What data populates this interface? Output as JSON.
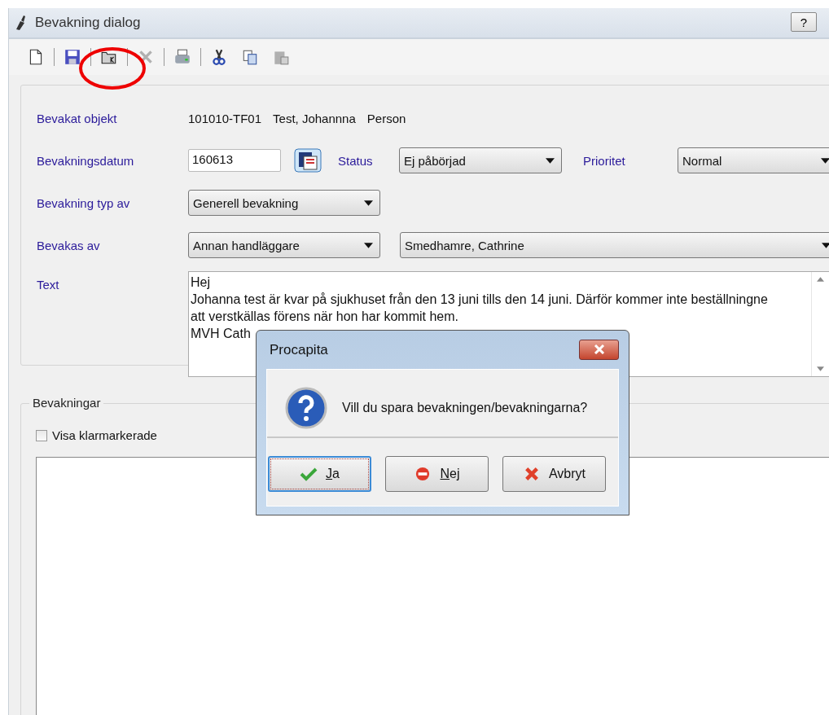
{
  "window": {
    "title": "Bevakning dialog",
    "help_button": "?"
  },
  "toolbar": {
    "groups": [
      [
        {
          "kind": "new",
          "disabled": false
        }
      ],
      [
        {
          "kind": "save",
          "disabled": false
        }
      ],
      [
        {
          "kind": "open",
          "disabled": false
        }
      ],
      [
        {
          "kind": "delete",
          "disabled": true
        }
      ],
      [
        {
          "kind": "print",
          "disabled": false
        }
      ],
      [
        {
          "kind": "cut",
          "disabled": false
        },
        {
          "kind": "copy",
          "disabled": false
        },
        {
          "kind": "paste",
          "disabled": true
        }
      ]
    ]
  },
  "form": {
    "object_label": "Bevakat objekt",
    "object_values": [
      "101010-TF01",
      "Test, Johannna",
      "Person"
    ],
    "date_label": "Bevakningsdatum",
    "date_value": "160613",
    "status_label": "Status",
    "status_value": "Ej påbörjad",
    "priority_label": "Prioritet",
    "priority_value": "Normal",
    "type_label": "Bevakning typ av",
    "type_value": "Generell bevakning",
    "watched_by_label": "Bevakas av",
    "watched_by_role": "Annan handläggare",
    "watched_by_person": "Smedhamre, Cathrine",
    "text_label": "Text",
    "text_lines": [
      "Hej",
      "Johanna test är kvar på sjukhuset från den 13 juni tills den 14 juni. Därför kommer inte beställningne",
      "att verstkällas förens när hon har kommit hem.",
      "MVH Cath"
    ]
  },
  "watches": {
    "title": "Bevakningar",
    "show_done": {
      "label": "Visa klarmarkerade",
      "checked": false
    }
  },
  "dialog": {
    "title": "Procapita",
    "message": "Vill du spara bevakningen/bevakningarna?",
    "buttons": [
      {
        "label": "Ja",
        "kind": "yes",
        "focused": true
      },
      {
        "label": "Nej",
        "kind": "no",
        "focused": false
      },
      {
        "label": "Avbryt",
        "kind": "cancel",
        "focused": false
      }
    ]
  }
}
